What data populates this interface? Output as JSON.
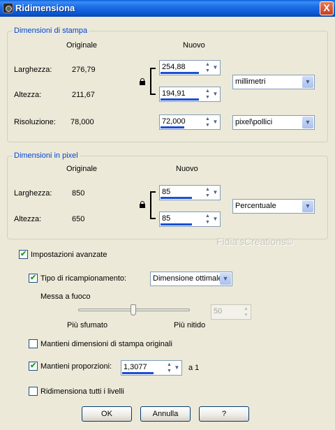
{
  "window": {
    "title": "Ridimensiona",
    "close_label": "X"
  },
  "print_dimensions": {
    "group_title": "Dimensioni di stampa",
    "col_original": "Originale",
    "col_new": "Nuovo",
    "width_label": "Larghezza:",
    "width_original": "276,79",
    "width_new": "254,88",
    "height_label": "Altezza:",
    "height_original": "211,67",
    "height_new": "194,91",
    "units": "millimetri",
    "resolution_label": "Risoluzione:",
    "resolution_original": "78,000",
    "resolution_new": "72,000",
    "resolution_units": "pixel\\pollici"
  },
  "pixel_dimensions": {
    "group_title": "Dimensioni in pixel",
    "col_original": "Originale",
    "col_new": "Nuovo",
    "width_label": "Larghezza:",
    "width_original": "850",
    "width_new": "85",
    "height_label": "Altezza:",
    "height_original": "650",
    "height_new": "85",
    "units": "Percentuale"
  },
  "watermark": "Fidia'sCreations©",
  "advanced": {
    "label": "Impostazioni avanzate",
    "checked": true,
    "resample_label": "Tipo di ricampionamento:",
    "resample_checked": true,
    "resample_value": "Dimensione ottimale",
    "sharpness_label": "Messa a fuoco",
    "sharpness_value": "50",
    "slider_min_label": "Più sfumato",
    "slider_max_label": "Più nitido"
  },
  "options": {
    "keep_print_size": "Mantieni dimensioni di stampa originali",
    "keep_print_size_checked": false,
    "keep_proportions": "Mantieni proporzioni:",
    "keep_proportions_checked": true,
    "ratio_value": "1,3077",
    "ratio_suffix": "a 1",
    "resize_all_layers": "Ridimensiona tutti i livelli",
    "resize_all_layers_checked": false
  },
  "buttons": {
    "ok": "OK",
    "cancel": "Annulla",
    "help": "?"
  },
  "colors": {
    "titlebar": "#0a58d0",
    "dialog_bg": "#ece9d8",
    "group_title": "#0046d5",
    "spin_bar": "#1c4fd6"
  }
}
